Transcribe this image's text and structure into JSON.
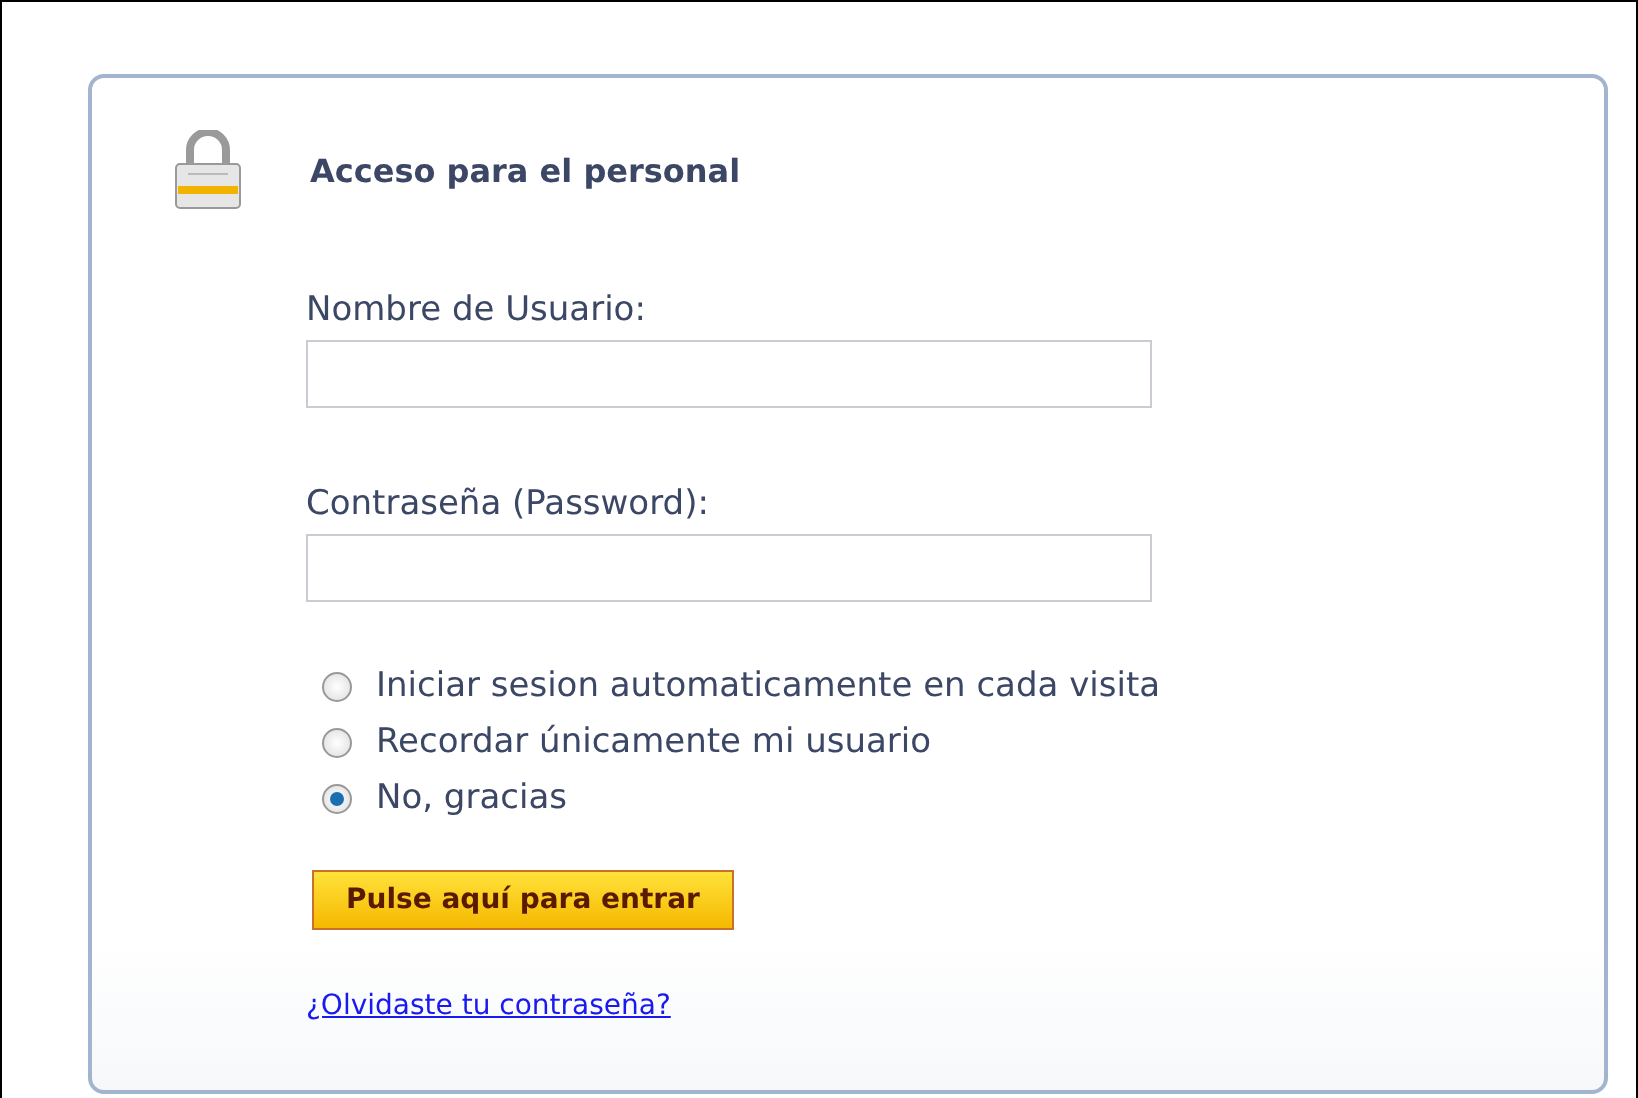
{
  "login_panel": {
    "title": "Acceso para el personal",
    "fields": [
      {
        "label": "Nombre de Usuario:"
      },
      {
        "label": "Contraseña (Password):"
      }
    ],
    "remember_options": [
      {
        "label": "Iniciar sesion automaticamente en cada visita",
        "selected": false
      },
      {
        "label": "Recordar únicamente mi usuario",
        "selected": false
      },
      {
        "label": "No, gracias",
        "selected": true
      }
    ],
    "submit_button": "Pulse aquí para entrar",
    "forgot_link": "¿Olvidaste tu contraseña?"
  }
}
